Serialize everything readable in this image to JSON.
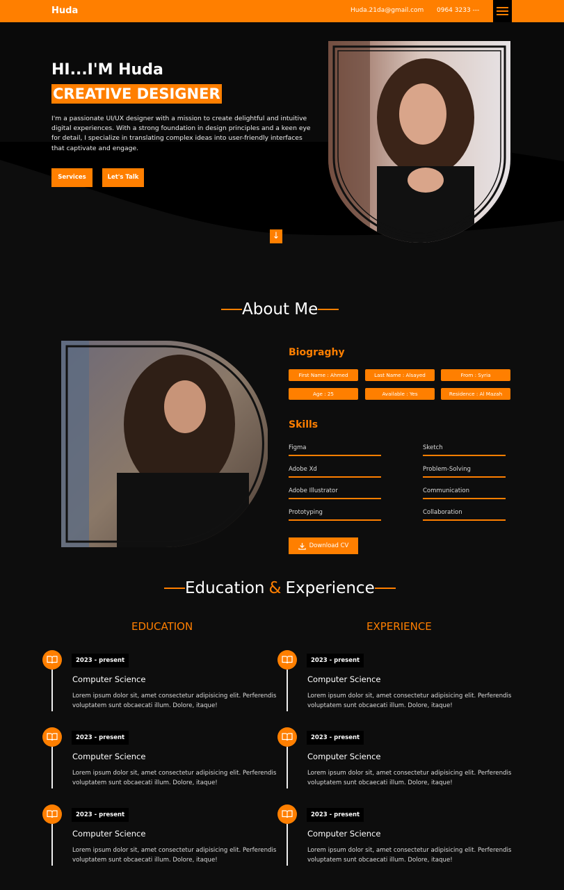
{
  "nav": {
    "logo": "Huda",
    "email": "Huda.21da@gmail.com",
    "phone": "0964 3233 ---"
  },
  "hero": {
    "greeting": "HI...I'M Huda",
    "role": "CREATIVE DESIGNER",
    "description": "I'm a passionate UI/UX designer with a mission to create delightful and intuitive digital experiences. With a strong foundation in design principles and a keen eye for detail, I specialize in translating complex ideas into user-friendly interfaces that captivate and engage.",
    "services_button": "Services",
    "talk_button": "Let's Talk",
    "scroll_icon": "arrow-down-icon"
  },
  "about": {
    "title": "About Me",
    "bio_heading": "Biograghy",
    "bio_chips": [
      "First Name : Ahmed",
      "Last Name : Alsayed",
      "From : Syria",
      "Age : 25",
      "Available : Yes",
      "Residence : Al Mazah"
    ],
    "skills_heading": "Skills",
    "skills_left": [
      "Figma",
      "Adobe Xd",
      "Adobe Illustrator",
      "Prototyping"
    ],
    "skills_right": [
      "Sketch",
      "Problem-Solving",
      "Communication",
      "Collaboration"
    ],
    "cv_button": "Download CV"
  },
  "resume": {
    "title_part1": "Education",
    "title_amp": "&",
    "title_part2": "Experience",
    "education_heading": "EDUCATION",
    "experience_heading": "EXPERIENCE",
    "education": [
      {
        "date": "2023 - present",
        "title": "Computer Science",
        "desc": "Lorem ipsum dolor sit, amet consectetur adipisicing elit. Perferendis voluptatem sunt obcaecati illum. Dolore, itaque!"
      },
      {
        "date": "2023 - present",
        "title": "Computer Science",
        "desc": "Lorem ipsum dolor sit, amet consectetur adipisicing elit. Perferendis voluptatem sunt obcaecati illum. Dolore, itaque!"
      },
      {
        "date": "2023 - present",
        "title": "Computer Science",
        "desc": "Lorem ipsum dolor sit, amet consectetur adipisicing elit. Perferendis voluptatem sunt obcaecati illum. Dolore, itaque!"
      }
    ],
    "experience": [
      {
        "date": "2023 - present",
        "title": "Computer Science",
        "desc": "Lorem ipsum dolor sit, amet consectetur adipisicing elit. Perferendis voluptatem sunt obcaecati illum. Dolore, itaque!"
      },
      {
        "date": "2023 - present",
        "title": "Computer Science",
        "desc": "Lorem ipsum dolor sit, amet consectetur adipisicing elit. Perferendis voluptatem sunt obcaecati illum. Dolore, itaque!"
      },
      {
        "date": "2023 - present",
        "title": "Computer Science",
        "desc": "Lorem ipsum dolor sit, amet consectetur adipisicing elit. Perferendis voluptatem sunt obcaecati illum. Dolore, itaque!"
      }
    ]
  },
  "colors": {
    "accent": "#ff7f00",
    "background": "#0d0d0d"
  }
}
